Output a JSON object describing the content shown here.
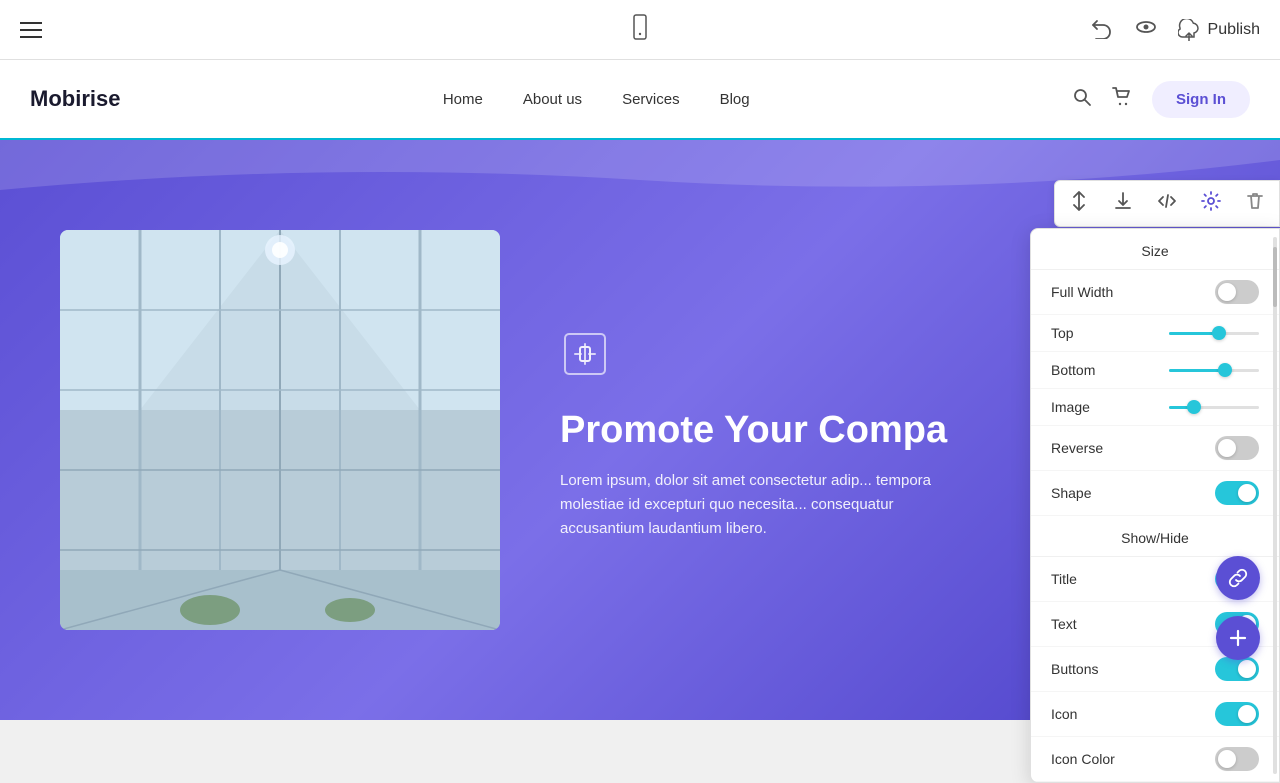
{
  "toolbar": {
    "hamburger_label": "menu",
    "mobile_icon": "📱",
    "undo_label": "undo",
    "preview_label": "preview",
    "publish_label": "Publish"
  },
  "nav": {
    "logo": "Mobirise",
    "links": [
      "Home",
      "About us",
      "Services",
      "Blog"
    ],
    "sign_in": "Sign In"
  },
  "section_toolbar": {
    "move_up": "↑↓",
    "download": "⬇",
    "code": "</>",
    "settings": "⚙",
    "delete": "🗑"
  },
  "settings_panel": {
    "size_title": "Size",
    "full_width_label": "Full Width",
    "full_width_on": false,
    "top_label": "Top",
    "top_value": 55,
    "bottom_label": "Bottom",
    "bottom_value": 62,
    "image_label": "Image",
    "image_value": 28,
    "reverse_label": "Reverse",
    "reverse_on": false,
    "shape_label": "Shape",
    "shape_on": true,
    "show_hide_title": "Show/Hide",
    "title_label": "Title",
    "title_on": true,
    "text_label": "Text",
    "text_on": true,
    "buttons_label": "Buttons",
    "buttons_on": true,
    "icon_label": "Icon",
    "icon_on": true,
    "icon_color_label": "Icon Color",
    "icon_color_on": false
  },
  "hero": {
    "icon": "⊟",
    "title": "Promote Your Compa",
    "text": "Lorem ipsum, dolor sit amet consectetur adip... tempora molestiae id excepturi quo necesita... consequatur accusantium laudantium libero."
  }
}
